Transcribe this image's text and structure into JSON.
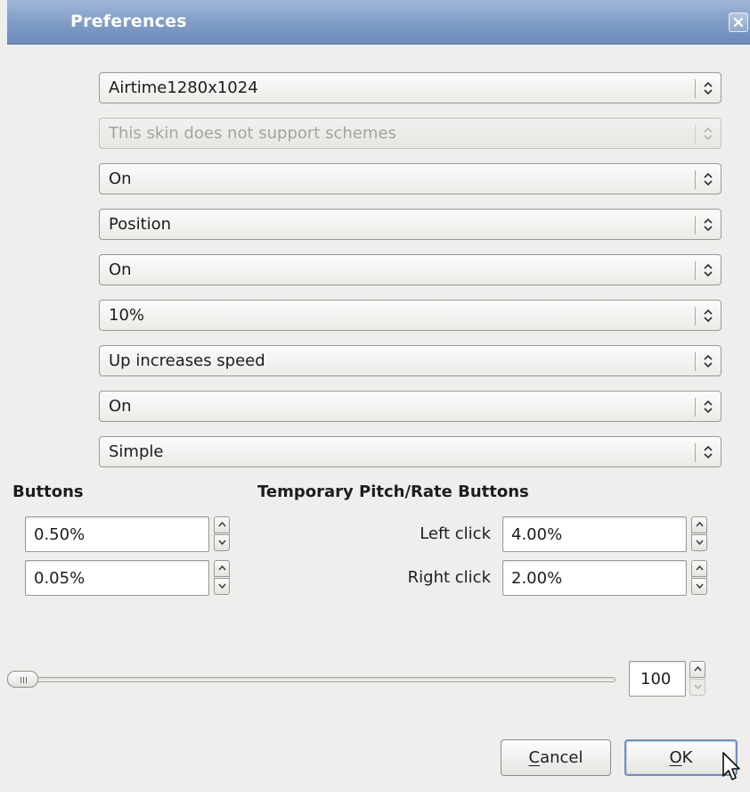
{
  "window": {
    "title": "Preferences"
  },
  "combos": [
    {
      "value": "Airtime1280x1024",
      "enabled": true
    },
    {
      "value": "This skin does not support schemes",
      "enabled": false
    },
    {
      "value": "On",
      "enabled": true
    },
    {
      "value": "Position",
      "enabled": true
    },
    {
      "value": "On",
      "enabled": true
    },
    {
      "value": "10%",
      "enabled": true
    },
    {
      "value": "Up increases speed",
      "enabled": true
    },
    {
      "value": "On",
      "enabled": true
    },
    {
      "value": "Simple",
      "enabled": true
    }
  ],
  "buttons_section": {
    "heading": "Buttons",
    "spin1_value": "0.50%",
    "spin2_value": "0.05%"
  },
  "temp_section": {
    "heading": "Temporary Pitch/Rate Buttons",
    "left_label": "Left click",
    "left_value": "4.00%",
    "right_label": "Right click",
    "right_value": "2.00%"
  },
  "slider": {
    "value": "100",
    "position_fraction": 0
  },
  "dialog_buttons": {
    "cancel_mnemonic": "C",
    "cancel_rest": "ancel",
    "ok_mnemonic": "O",
    "ok_rest": "K"
  },
  "icons": {
    "close": "close-icon",
    "combo_arrows": "updown-arrows-icon",
    "spin_up": "spin-up-arrow-icon",
    "spin_down": "spin-down-arrow-icon",
    "cursor": "mouse-pointer-icon"
  },
  "colors": {
    "titlebar": "#7f9cc6",
    "default_button_border": "#6b8fc4"
  }
}
